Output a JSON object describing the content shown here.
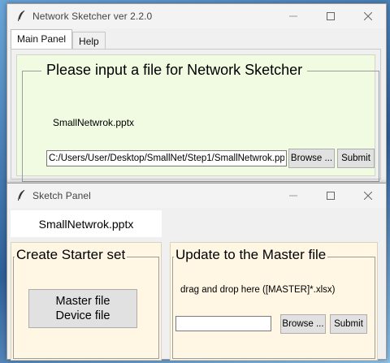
{
  "main_window": {
    "title": "Network Sketcher  ver 2.2.0",
    "tabs": [
      {
        "label": "Main Panel",
        "active": true
      },
      {
        "label": "Help",
        "active": false
      }
    ],
    "group_title": "Please input a file for Network Sketcher",
    "file_name": "SmallNetwrok.pptx",
    "path_value": "C:/Users/User/Desktop/SmallNet/Step1/SmallNetwrok.pp",
    "browse_label": "Browse ...",
    "submit_label": "Submit"
  },
  "sketch_window": {
    "title": "Sketch Panel",
    "file_name": "SmallNetwrok.pptx",
    "starter": {
      "title": "Create Starter set",
      "button_line1": "Master file",
      "button_line2": "Device file"
    },
    "update": {
      "title": "Update to the Master file",
      "drop_text": "drag and drop here ([MASTER]*.xlsx)",
      "input_value": "",
      "browse_label": "Browse ...",
      "submit_label": "Submit"
    }
  },
  "icons": [
    "feather-icon",
    "minimize-icon",
    "maximize-icon",
    "close-icon"
  ],
  "colors": {
    "green_panel": "#f0fbe2",
    "cream_panel": "#fff7e4",
    "window_bg": "#f0f0f0"
  }
}
